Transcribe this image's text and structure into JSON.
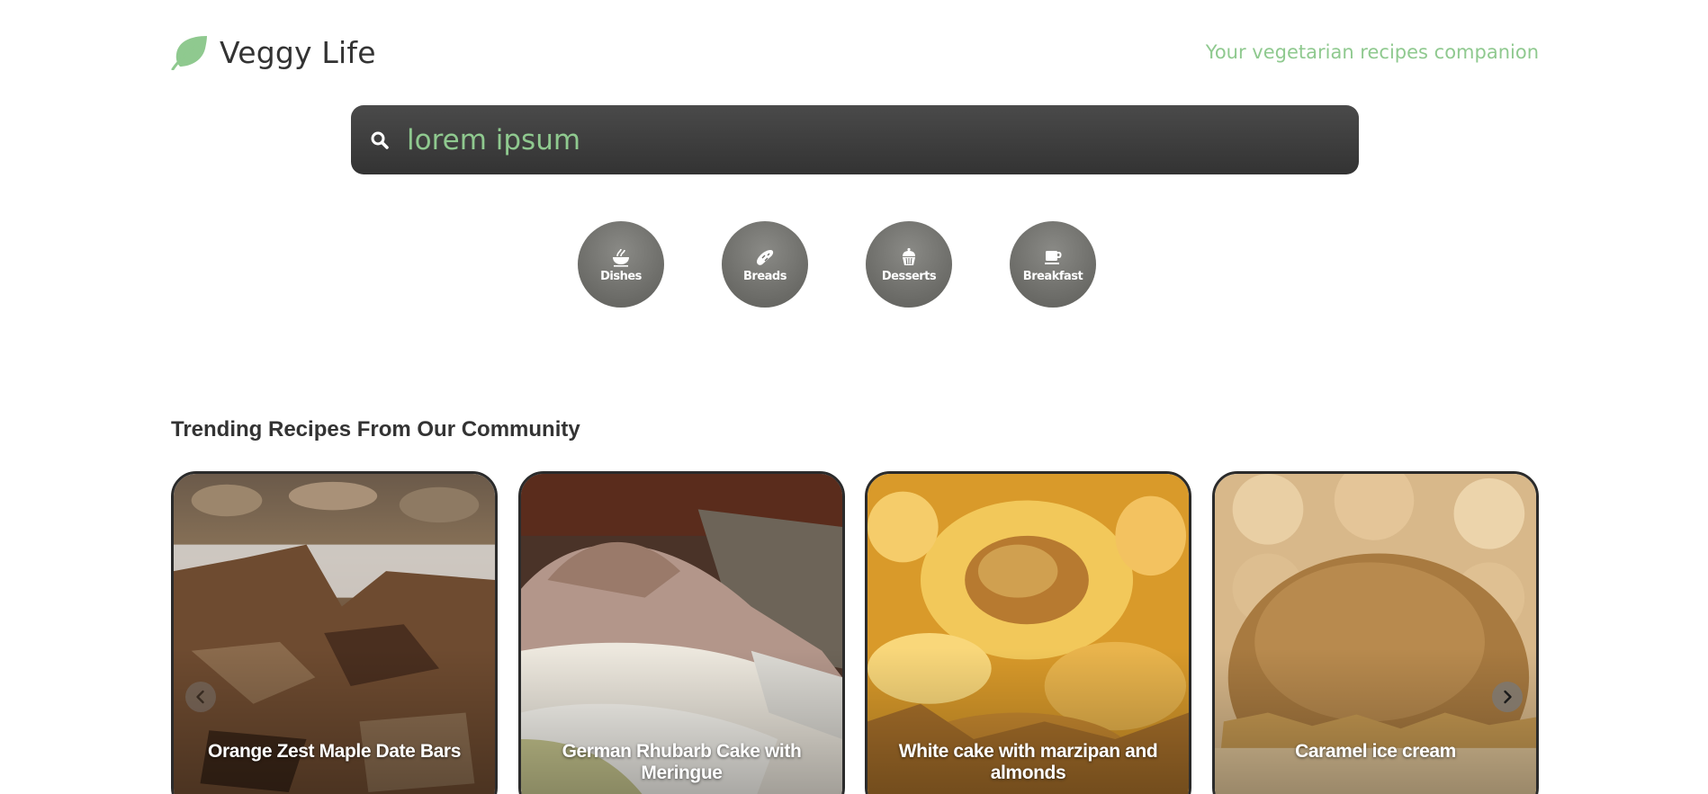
{
  "brand": {
    "name": "Veggy Life",
    "tagline": "Your vegetarian recipes companion",
    "accent_color": "#8fc98f"
  },
  "search": {
    "value": "lorem ipsum",
    "icon": "search-icon"
  },
  "categories": [
    {
      "label": "Dishes",
      "icon": "noodle-bowl-icon"
    },
    {
      "label": "Breads",
      "icon": "bread-icon"
    },
    {
      "label": "Desserts",
      "icon": "cupcake-icon"
    },
    {
      "label": "Breakfast",
      "icon": "coffee-cup-icon"
    }
  ],
  "trending": {
    "title": "Trending Recipes From Our Community",
    "recipes": [
      {
        "title": "Orange Zest Maple Date Bars"
      },
      {
        "title": "German Rhubarb Cake with Meringue"
      },
      {
        "title": "White cake with marzipan and almonds"
      },
      {
        "title": "Caramel ice cream"
      }
    ],
    "prev_icon": "chevron-left-icon",
    "next_icon": "chevron-right-icon"
  }
}
